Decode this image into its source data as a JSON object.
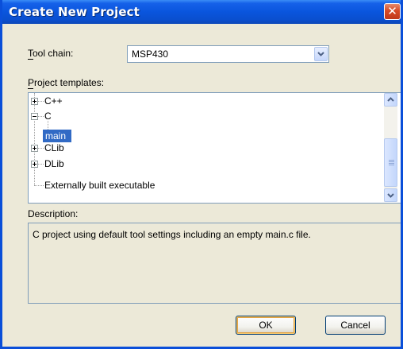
{
  "window": {
    "title": "Create New Project",
    "close_glyph": "✕"
  },
  "toolchain": {
    "label": "Tool chain:",
    "value": "MSP430"
  },
  "templates": {
    "label": "Project templates:",
    "items": [
      {
        "label": "C++",
        "expander": "collapsed"
      },
      {
        "label": "C",
        "expander": "expanded"
      },
      {
        "label": "main",
        "selected": true
      },
      {
        "label": "CLib",
        "expander": "collapsed"
      },
      {
        "label": "DLib",
        "expander": "collapsed"
      },
      {
        "label": "Externally built executable"
      }
    ]
  },
  "description": {
    "label": "Description:",
    "text": "C project using default tool settings including an empty main.c file."
  },
  "buttons": {
    "ok": "OK",
    "cancel": "Cancel"
  },
  "colors": {
    "title_bar": "#0a55dd",
    "selection": "#316ac5",
    "dialog_face": "#ece9d8"
  },
  "icons": {
    "close": "close-icon",
    "dropdown": "chevron-down-icon",
    "scroll_up": "scroll-up-icon",
    "scroll_down": "scroll-down-icon",
    "expand": "plus-icon",
    "collapse": "minus-icon"
  }
}
